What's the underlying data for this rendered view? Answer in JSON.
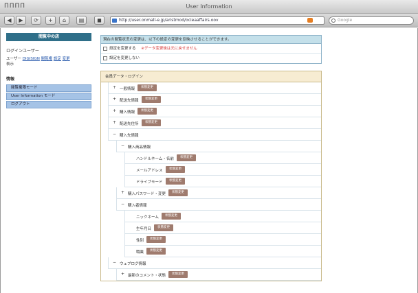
{
  "window": {
    "menu_glyphs": "ΠΠΠΠ",
    "title": "User Information"
  },
  "toolbar": {
    "back": "◀",
    "forward": "▶",
    "reload": "⟳",
    "add": "+",
    "home": "⌂",
    "print": "▤",
    "stop": "◼",
    "url": "http://user.onmall-e.jp/aristmod/ocieaaffairs.oov",
    "search_placeholder": "Google"
  },
  "sidebar": {
    "header": "閲覧中の店",
    "heading": "ログインユーザー",
    "user_text": "ユーザー",
    "user_link1": "DIGISIGN",
    "user_link2": "閲覧権",
    "user_link3": "設定",
    "user_link4": "変更",
    "user_suffix": "表示",
    "section": "情報",
    "nav": [
      {
        "label": "閲覧権限モード"
      },
      {
        "label": "User Information モード"
      },
      {
        "label": "ログアウト"
      }
    ]
  },
  "notice": {
    "header": "現在の閲覧状況の変更は、以下の設定の変更を反映させることができます。",
    "options": [
      {
        "label": "設定を変更する",
        "warning": "※データ変更後は元に戻せません"
      },
      {
        "label": "設定を変更しない",
        "warning": ""
      }
    ]
  },
  "tree": {
    "header": "会員データ・ログイン",
    "rows": [
      {
        "label": "一般情報",
        "toggle": "+",
        "badge": "状態変更",
        "level": 1
      },
      {
        "label": "配送先情報",
        "toggle": "+",
        "badge": "状態変更",
        "level": 1
      },
      {
        "label": "購入情報",
        "toggle": "+",
        "badge": "状態変更",
        "level": 1
      },
      {
        "label": "配送先住所",
        "toggle": "+",
        "badge": "状態変更",
        "level": 1
      },
      {
        "label": "購入先情報",
        "toggle": "−",
        "badge": "",
        "level": 1
      },
      {
        "label": "購入商品情報",
        "toggle": "−",
        "badge": "",
        "level": 2
      },
      {
        "label": "ハンドルネーム・名前",
        "toggle": "",
        "badge": "状態変更",
        "level": 3
      },
      {
        "label": "メールアドレス",
        "toggle": "",
        "badge": "状態変更",
        "level": 3
      },
      {
        "label": "ドライブモード",
        "toggle": "",
        "badge": "状態変更",
        "level": 3
      },
      {
        "label": "購入パスワード・変更",
        "toggle": "+",
        "badge": "状態変更",
        "level": 2
      },
      {
        "label": "購入者情報",
        "toggle": "−",
        "badge": "",
        "level": 2
      },
      {
        "label": "ニックネーム",
        "toggle": "",
        "badge": "状態変更",
        "level": 3
      },
      {
        "label": "生年月日",
        "toggle": "",
        "badge": "状態変更",
        "level": 3
      },
      {
        "label": "性別",
        "toggle": "",
        "badge": "状態変更",
        "level": 3
      },
      {
        "label": "職業",
        "toggle": "",
        "badge": "状態変更",
        "level": 3
      },
      {
        "label": "ウェブログ情報",
        "toggle": "−",
        "badge": "",
        "level": 1
      },
      {
        "label": "最新のコメント・状態",
        "toggle": "+",
        "badge": "状態変更",
        "level": 2
      }
    ]
  }
}
